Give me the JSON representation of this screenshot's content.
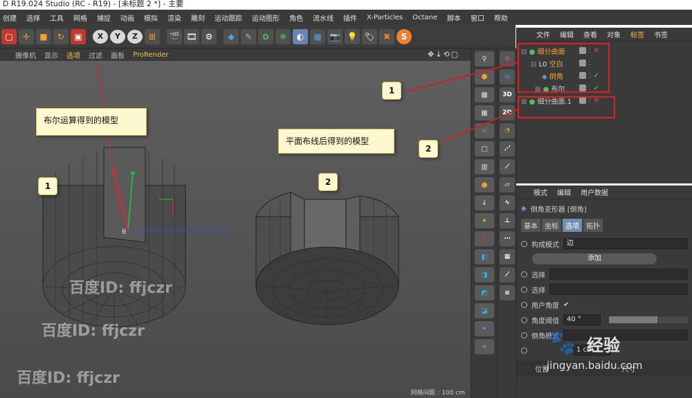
{
  "window": {
    "title": "D R19.024 Studio (RC - R19) - [未标题 2 *] - 主要"
  },
  "menu": [
    "创建",
    "选择",
    "工具",
    "网格",
    "捕捉",
    "动画",
    "模拟",
    "渲染",
    "雕刻",
    "运动跟踪",
    "运动图形",
    "角色",
    "流水线",
    "插件",
    "X-Particles",
    "Octane",
    "脚本",
    "窗口",
    "帮助"
  ],
  "toolbar": {
    "axis_x": "X",
    "axis_y": "Y",
    "axis_z": "Z"
  },
  "viewport": {
    "menu": [
      "摄像机",
      "显示",
      "选项",
      "过滤",
      "面板",
      "ProRender"
    ],
    "active_menu": "选项",
    "footer": "网格间距 : 100 cm"
  },
  "callouts": {
    "boolean_model": "布尔运算得到的模型",
    "plane_model": "平面布线后得到的模型",
    "badge_1": "1",
    "badge_2": "2",
    "badge_right_1": "1",
    "badge_right_2": "2"
  },
  "object_manager": {
    "menu": [
      "文件",
      "编辑",
      "查看",
      "对象",
      "标签",
      "书签"
    ],
    "active_menu": "标签",
    "objects": [
      {
        "name": "细分曲面",
        "status": "x"
      },
      {
        "name": "空白",
        "status": ""
      },
      {
        "name": "倒角",
        "status": "check"
      },
      {
        "name": "布尔",
        "status": "check"
      },
      {
        "name": "细分曲面.1",
        "status": "x"
      }
    ]
  },
  "palette": {
    "label_3d": "3D",
    "label_2d": "2D"
  },
  "attribute_manager": {
    "menu": [
      "模式",
      "编辑",
      "用户数据"
    ],
    "object_title": "倒角变形器 [倒角]",
    "tabs": [
      "基本",
      "坐标",
      "选项",
      "拓扑"
    ],
    "active_tab": "选项",
    "rows": {
      "component_mode_label": "构成模式",
      "component_mode_value": "边",
      "add_button": "添加",
      "select_1": "选择",
      "select_2": "选择",
      "user_angle": "用户角度",
      "user_angle_check": "✔",
      "angle_threshold_label": "角度阈值",
      "angle_threshold_value": "40 °",
      "angle_threshold_fraction": 0.6,
      "bevel_mode_label": "倒角模式",
      "offset_value": "1 cm",
      "position_label": "位置",
      "size_label": "尺寸"
    }
  },
  "watermarks": {
    "text_1": "百度ID: ffjczr",
    "text_2": "百度ID: ffjczr",
    "text_3": "百度ID: ffjczr",
    "baidu_brand": "经验",
    "baidu_url": "jingyan.baidu.com"
  }
}
